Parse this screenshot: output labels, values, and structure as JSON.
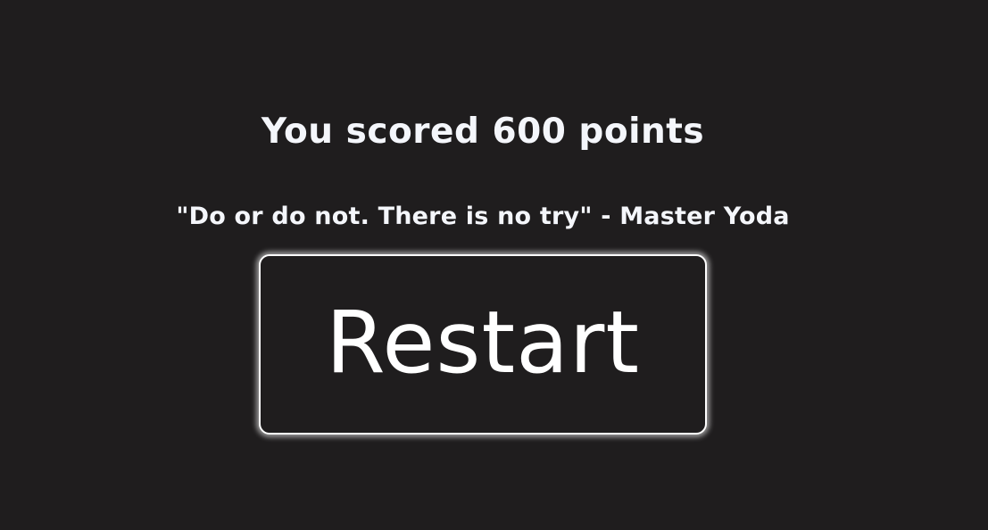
{
  "game_over": {
    "score_text": "You scored 600 points",
    "quote_text": "\"Do or do not. There is no try\" - Master Yoda",
    "restart_label": "Restart"
  },
  "colors": {
    "background": "#1f1d1e",
    "text": "#f4f6fb",
    "button_border": "#ffffff"
  }
}
